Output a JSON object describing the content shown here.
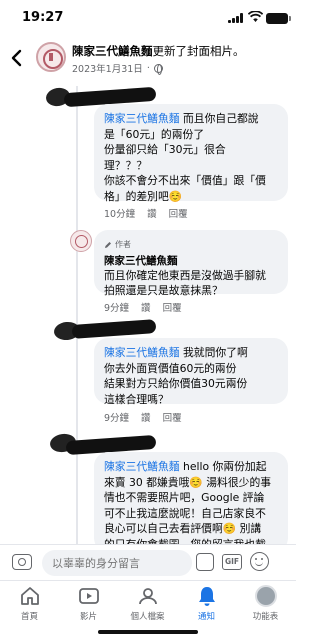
{
  "status_bar": {
    "time": "19:27"
  },
  "header": {
    "page_name": "陳家三代鱔魚麵",
    "action_text": "更新了封面相片。",
    "date": "2023年1月31日",
    "icon": "globe-icon"
  },
  "comments": [
    {
      "mention": "陳家三代鱔魚麵",
      "lines": [
        " 而且你自己都說",
        "是「60元」的兩份了",
        "份量卻只給「30元」很合",
        "理？？？",
        "你該不會分不出來「價值」跟「價",
        "格」的差別吧☺️"
      ],
      "time": "10分鐘",
      "like": "讚",
      "reply": "回覆"
    },
    {
      "author_tag": "作者",
      "author": "陳家三代鱔魚麵",
      "lines": [
        "而且你確定他東西是沒做過手腳就",
        "拍照還是只是故意抹黑？"
      ],
      "time": "9分鐘",
      "like": "讚",
      "reply": "回覆"
    },
    {
      "mention": "陳家三代鱔魚麵",
      "lines": [
        " 我就問你了啊",
        "你去外面買價值60元的兩份",
        "結果對方只給你價值30元兩份",
        "這樣合理嗎？"
      ],
      "time": "9分鐘",
      "like": "讚",
      "reply": "回覆"
    },
    {
      "mention": "陳家三代鱔魚麵",
      "lines": [
        " hello 你兩份加起",
        "來賣 30 都嫌貴哦☺️ 湯料很少的事",
        "情也不需要照片吧，Google 評論",
        "可不止我這麼說呢！自己店家良不",
        "良心可以自己去看評價啊☺️ 別講",
        "的只有你會截圖，您的留言我也截"
      ]
    }
  ],
  "composer": {
    "placeholder": "以辜辜的身分留言"
  },
  "tabs": [
    {
      "label": "首頁",
      "icon": "home-icon"
    },
    {
      "label": "影片",
      "icon": "video-icon"
    },
    {
      "label": "個人檔案",
      "icon": "profile-icon"
    },
    {
      "label": "通知",
      "icon": "bell-icon",
      "active": true
    },
    {
      "label": "功能表",
      "icon": "menu-avatar-icon"
    }
  ],
  "colors": {
    "accent": "#1b74e4",
    "bubble": "#f0f2f5",
    "meta": "#65676b"
  }
}
